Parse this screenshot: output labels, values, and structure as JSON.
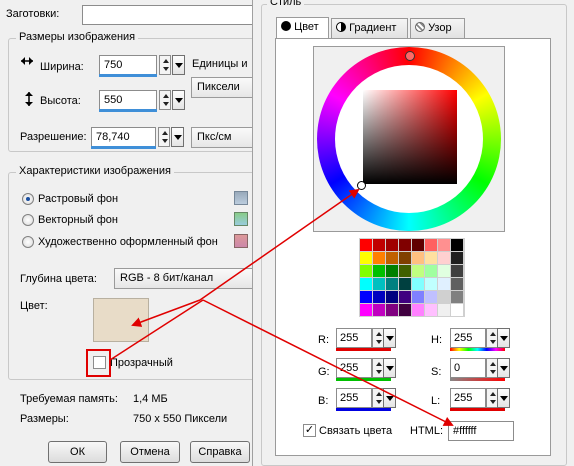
{
  "left": {
    "bookmarks_label": "Заготовки:",
    "bookmarks_value": "",
    "size_group": {
      "title": "Размеры изображения",
      "width_label": "Ширина:",
      "width_value": "750",
      "height_label": "Высота:",
      "height_value": "550",
      "units_label": "Единицы и",
      "units_value": "Пиксели",
      "resolution_label": "Разрешение:",
      "resolution_value": "78,740",
      "resolution_units": "Пкс/см"
    },
    "props_group": {
      "title": "Характеристики изображения",
      "raster_label": "Растровый фон",
      "vector_label": "Векторный фон",
      "art_label": "Художественно оформленный фон",
      "selected": "raster",
      "depth_label": "Глубина цвета:",
      "depth_value": "RGB - 8 бит/канал",
      "color_label": "Цвет:",
      "color_swatch": "#e8dcc8",
      "transparent_label": "Прозрачный",
      "transparent_checked": false
    },
    "memory_label": "Требуемая память:",
    "memory_value": "1,4 МБ",
    "dims_label": "Размеры:",
    "dims_value": "750 x 550 Пиксели",
    "buttons": {
      "ok": "ОК",
      "cancel": "Отмена",
      "help": "Справка"
    }
  },
  "right": {
    "title": "Стиль",
    "tabs": [
      {
        "label": "Цвет",
        "icon": "black-dot-icon",
        "active": true
      },
      {
        "label": "Градиент",
        "icon": "gradient-icon",
        "active": false
      },
      {
        "label": "Узор",
        "icon": "pattern-icon",
        "active": false
      }
    ],
    "palette": [
      [
        "#ff0000",
        "#c00000",
        "#a00000",
        "#800000",
        "#600000",
        "#ff6060",
        "#ff9090",
        "#000000"
      ],
      [
        "#ffff00",
        "#ff8000",
        "#c06000",
        "#804000",
        "#ffc080",
        "#ffe0a0",
        "#ffd0d0",
        "#202020"
      ],
      [
        "#80ff00",
        "#00c000",
        "#008000",
        "#406000",
        "#c0ff80",
        "#a0ffa0",
        "#e0ffe0",
        "#404040"
      ],
      [
        "#00ffff",
        "#00c0c0",
        "#008080",
        "#004040",
        "#80ffff",
        "#c0ffff",
        "#e0f0ff",
        "#606060"
      ],
      [
        "#0000ff",
        "#0000c0",
        "#000080",
        "#400080",
        "#8080ff",
        "#c0c0ff",
        "#d0d0d0",
        "#808080"
      ],
      [
        "#ff00ff",
        "#c000c0",
        "#800080",
        "#400040",
        "#ff80ff",
        "#ffc0ff",
        "#f0f0f0",
        "#ffffff"
      ]
    ],
    "r_label": "R:",
    "r_value": "255",
    "g_label": "G:",
    "g_value": "255",
    "b_label": "B:",
    "b_value": "255",
    "h_label": "H:",
    "h_value": "255",
    "s_label": "S:",
    "s_value": "0",
    "l_label": "L:",
    "l_value": "255",
    "link_colors_label": "Связать цвета",
    "link_colors_checked": true,
    "html_label": "HTML:",
    "html_value": "#ffffff"
  },
  "colors": {
    "annotation_red": "#e00000",
    "r_line": "#e00000",
    "g_line": "#00c000",
    "b_line": "#0000e0",
    "accent_blue": "#3f8fd8"
  }
}
